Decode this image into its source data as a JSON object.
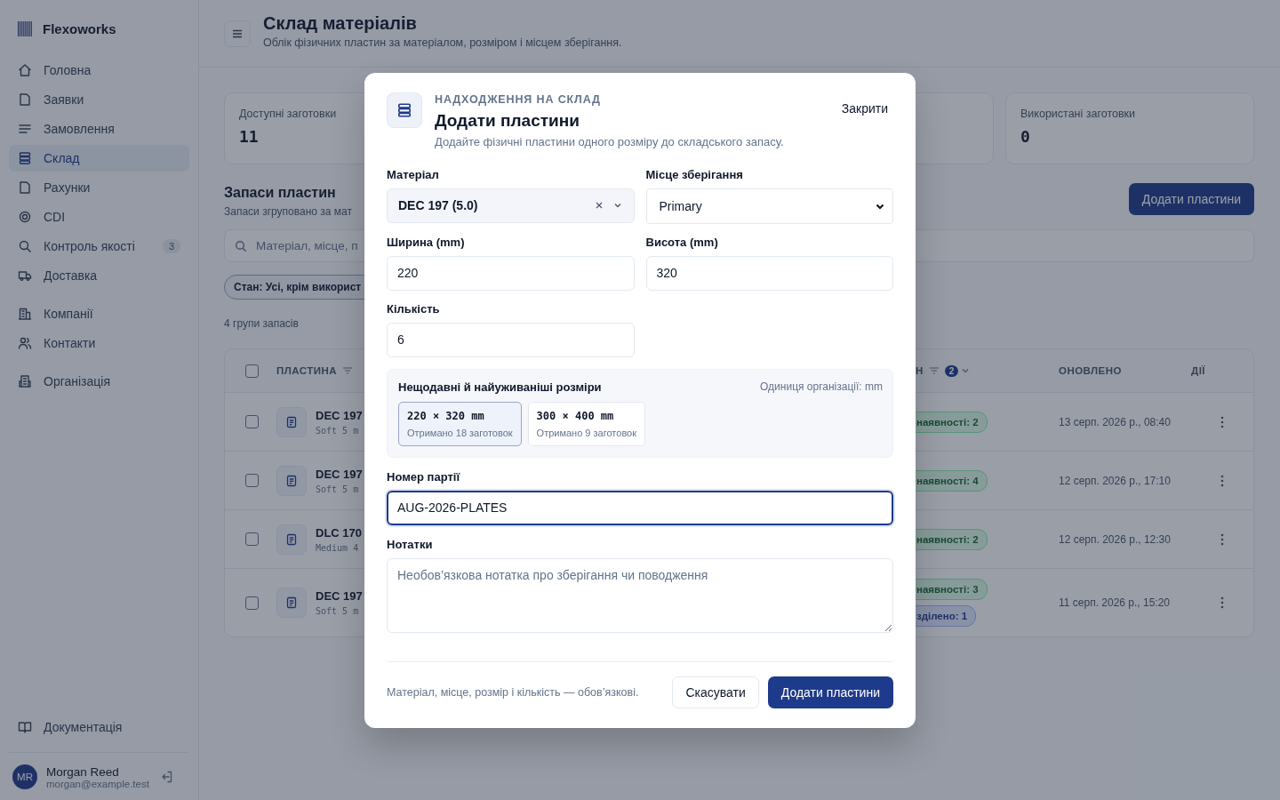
{
  "sidebar": {
    "brand": "Flexoworks",
    "nav_groups": [
      [
        {
          "label": "Головна",
          "selected": false
        },
        {
          "label": "Заявки",
          "selected": false
        },
        {
          "label": "Замовлення",
          "selected": false
        },
        {
          "label": "Склад",
          "selected": true
        },
        {
          "label": "Рахунки",
          "selected": false
        },
        {
          "label": "CDI",
          "selected": false
        },
        {
          "label": "Контроль якості",
          "selected": false,
          "badge": "3"
        },
        {
          "label": "Доставка",
          "selected": false
        }
      ],
      [
        {
          "label": "Компанії",
          "selected": false
        },
        {
          "label": "Контакти",
          "selected": false
        }
      ],
      [
        {
          "label": "Організація",
          "selected": false
        }
      ]
    ],
    "docs_link": "Документація",
    "user": {
      "initials": "MR",
      "name": "Morgan Reed",
      "email": "morgan@example.test"
    }
  },
  "header": {
    "title": "Склад матеріалів",
    "subtitle": "Облік фізичних пластин за матеріалом, розміром і місцем зберігання."
  },
  "stats": [
    {
      "label": "Доступні заготовки",
      "value": "11"
    },
    {
      "label": "Використані заготовки",
      "value": "0"
    }
  ],
  "section": {
    "title": "Запаси пластин",
    "subtitle": "Запаси згруповано за мат",
    "add_label": "Додати пластини"
  },
  "search": {
    "placeholder": "Матеріал, місце, п"
  },
  "filter_chip": "Стан: Усі, крім використ",
  "group_count": "4 групи запасів",
  "table": {
    "all_checked": false,
    "columns": [
      {
        "label": "ПЛАСТИНА",
        "filter": true
      },
      {
        "label": "Н",
        "filter": true,
        "filter_count": "2"
      },
      {
        "label": "ОНОВЛЕНО",
        "filter": false
      },
      {
        "label": "ДІЇ",
        "filter": false
      }
    ],
    "rows": [
      {
        "checked": false,
        "name": "DEC 197",
        "spec": "Soft 5 m",
        "statuses": [
          {
            "kind": "available",
            "label": "наявності: 2"
          }
        ],
        "updated": "13 серп. 2026 р., 08:40"
      },
      {
        "checked": false,
        "name": "DEC 197",
        "spec": "Soft 5 m",
        "statuses": [
          {
            "kind": "available",
            "label": "наявності: 4"
          }
        ],
        "updated": "12 серп. 2026 р., 17:10"
      },
      {
        "checked": false,
        "name": "DLC 170",
        "spec": "Medium 4",
        "statuses": [
          {
            "kind": "available",
            "label": "наявності: 2"
          }
        ],
        "updated": "12 серп. 2026 р., 12:30"
      },
      {
        "checked": false,
        "name": "DEC 197",
        "spec": "Soft 5 m",
        "statuses": [
          {
            "kind": "available",
            "label": "наявності: 3"
          },
          {
            "kind": "split",
            "label": "зділено: 1"
          }
        ],
        "updated": "11 серп. 2026 р., 15:20"
      }
    ]
  },
  "dialog": {
    "eyebrow": "НАДХОДЖЕННЯ НА СКЛАД",
    "title": "Додати пластини",
    "description": "Додайте фізичні пластини одного розміру до складського запасу.",
    "close_label": "Закрити",
    "material": {
      "label": "Матеріал",
      "value": "DEC 197 (5.0)"
    },
    "location": {
      "label": "Місце зберігання",
      "value": "Primary"
    },
    "width": {
      "label": "Ширина (mm)",
      "value": "220"
    },
    "height": {
      "label": "Висота (mm)",
      "value": "320"
    },
    "quantity": {
      "label": "Кількість",
      "value": "6"
    },
    "sizes": {
      "title": "Нещодавні й найуживаніші розміри",
      "unit_note": "Одиниця організації: mm",
      "options": [
        {
          "size": "220 × 320 mm",
          "note": "Отримано 18 заготовок",
          "selected": true
        },
        {
          "size": "300 × 400 mm",
          "note": "Отримано 9 заготовок",
          "selected": false
        }
      ]
    },
    "batch": {
      "label": "Номер партії",
      "value": "AUG-2026-PLATES",
      "focused": true
    },
    "notes": {
      "label": "Нотатки",
      "placeholder": "Необов’язкова нотатка про зберігання чи поводження"
    },
    "footer_note": "Матеріал, місце, розмір і кількість — обов’язкові.",
    "cancel_label": "Скасувати",
    "submit_label": "Додати пластини"
  }
}
